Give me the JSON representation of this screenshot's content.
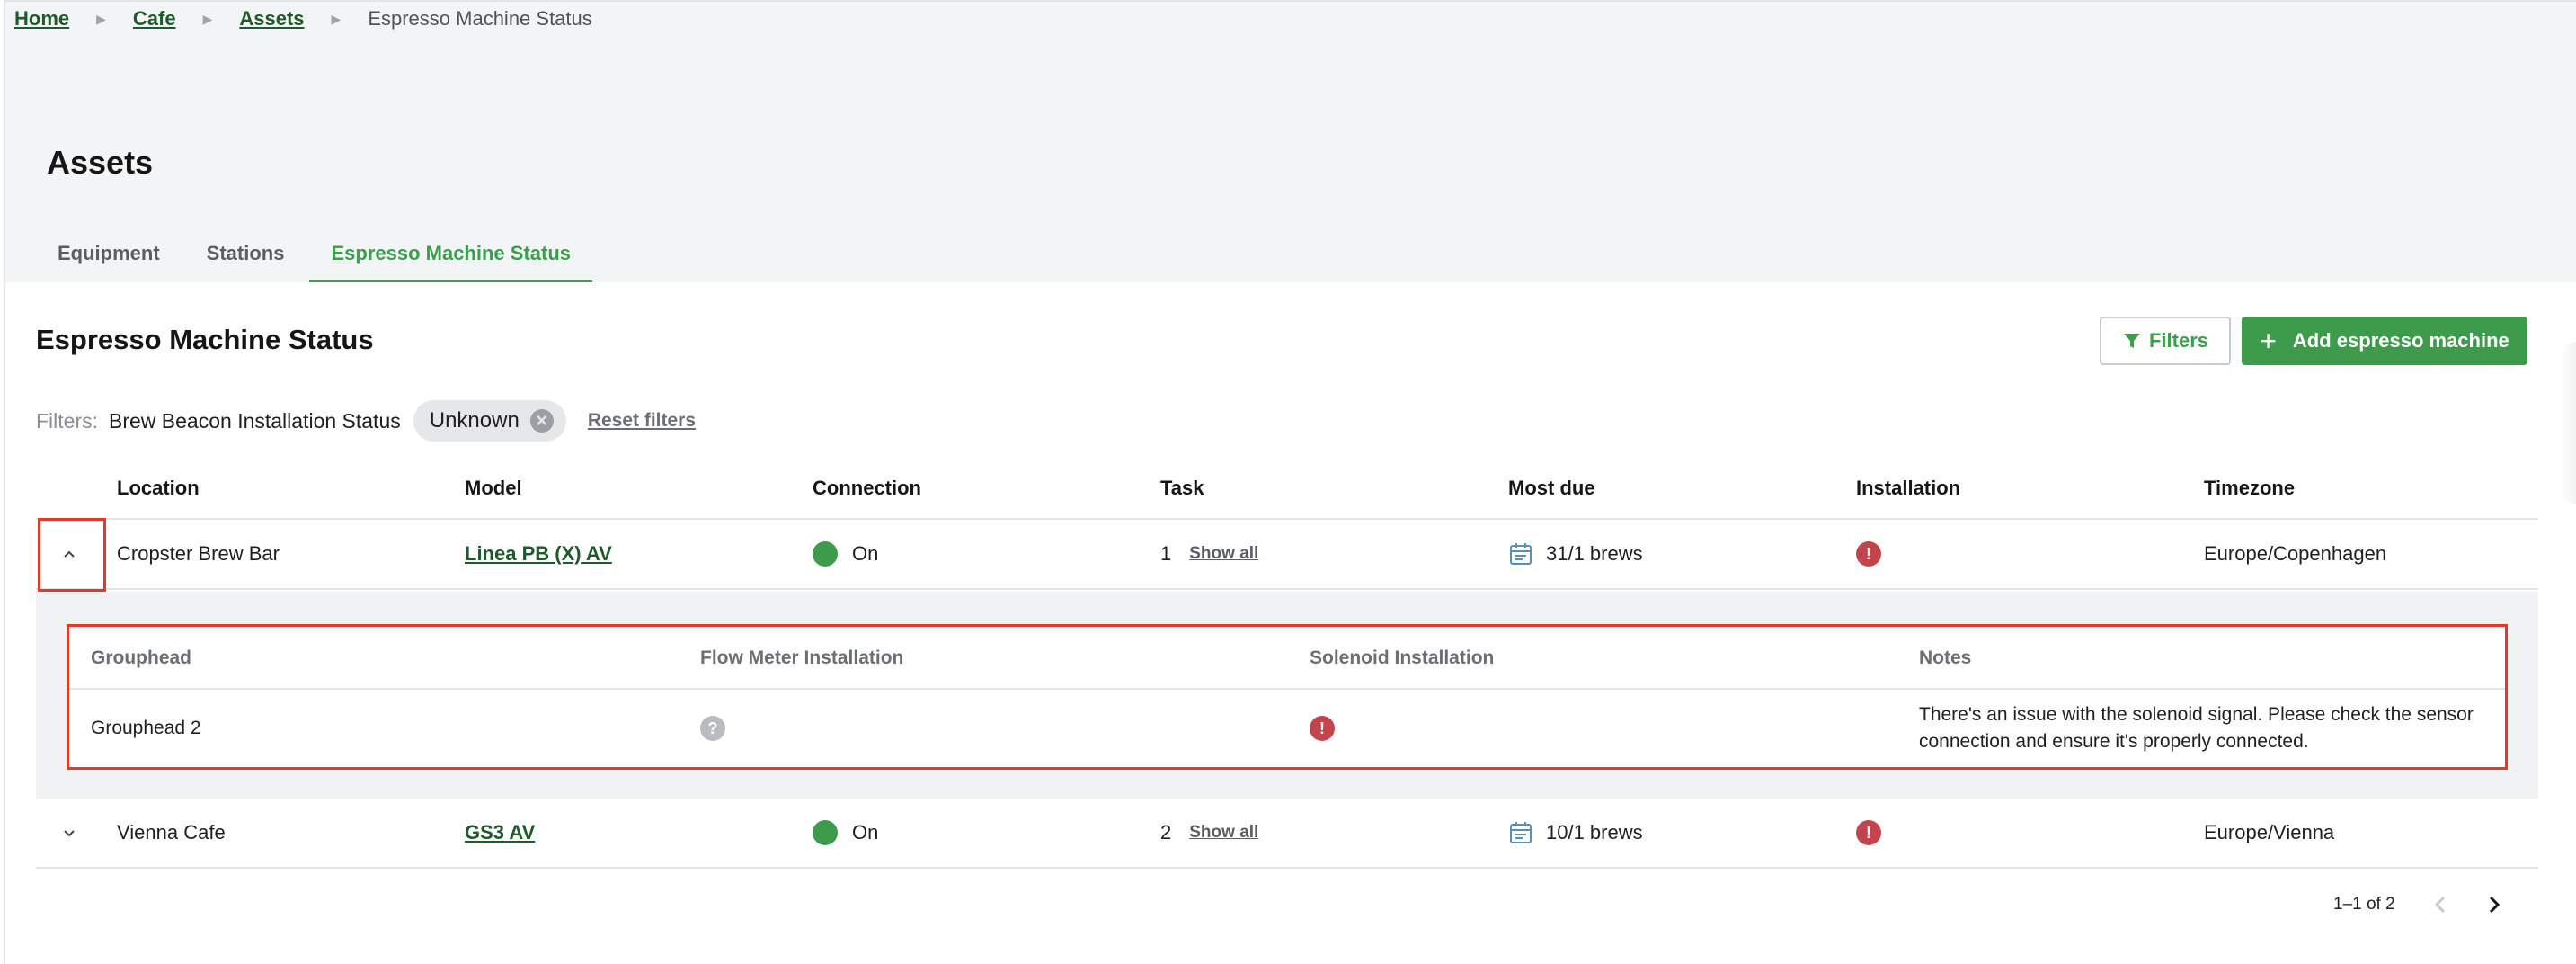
{
  "breadcrumb": {
    "items": [
      "Home",
      "Cafe",
      "Assets"
    ],
    "current": "Espresso Machine Status"
  },
  "page": {
    "title": "Assets"
  },
  "tabs": [
    {
      "label": "Equipment",
      "active": false
    },
    {
      "label": "Stations",
      "active": false
    },
    {
      "label": "Espresso Machine Status",
      "active": true
    }
  ],
  "section": {
    "title": "Espresso Machine Status",
    "filters_button": "Filters",
    "add_button": "Add espresso machine"
  },
  "filters": {
    "label": "Filters:",
    "name": "Brew Beacon Installation Status",
    "chip_value": "Unknown",
    "reset": "Reset filters"
  },
  "table": {
    "columns": [
      "Location",
      "Model",
      "Connection",
      "Task",
      "Most due",
      "Installation",
      "Timezone"
    ],
    "rows": [
      {
        "location": "Cropster Brew Bar",
        "model": "Linea PB (X) AV",
        "connection": "On",
        "task_count": "1",
        "show_all": "Show all",
        "most_due": "31/1 brews",
        "installation": "error",
        "timezone": "Europe/Copenhagen",
        "expanded": true
      },
      {
        "location": "Vienna Cafe",
        "model": "GS3 AV",
        "connection": "On",
        "task_count": "2",
        "show_all": "Show all",
        "most_due": "10/1 brews",
        "installation": "error",
        "timezone": "Europe/Vienna",
        "expanded": false
      }
    ]
  },
  "subtable": {
    "columns": [
      "Grouphead",
      "Flow Meter Installation",
      "Solenoid Installation",
      "Notes"
    ],
    "rows": [
      {
        "grouphead": "Grouphead 2",
        "flow_meter": "unknown",
        "solenoid": "error",
        "notes": "There's an issue with the solenoid signal. Please check the sensor connection and ensure it's properly connected."
      }
    ]
  },
  "pagination": {
    "label": "1–1 of 2"
  },
  "colors": {
    "accent": "#3aa04a",
    "primary_button": "#3f9b4c",
    "link": "#1e5a2a",
    "error": "#c4444d",
    "highlight": "#e03a2a"
  }
}
